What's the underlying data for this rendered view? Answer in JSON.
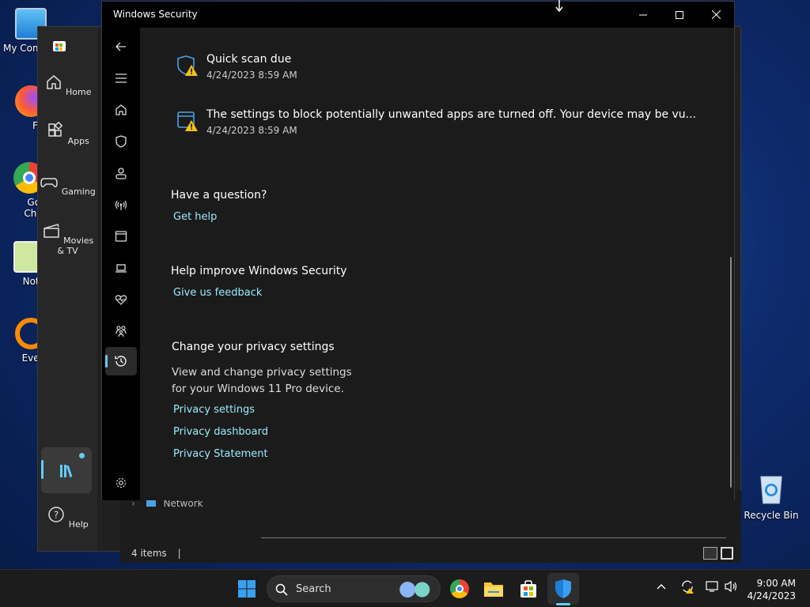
{
  "desktop": {
    "icons": [
      {
        "label": "My Com"
      },
      {
        "label": "Firefo"
      },
      {
        "label": "Goog Chron"
      },
      {
        "label": "Notepa"
      },
      {
        "label": "Everyth"
      }
    ],
    "recycle_bin": {
      "label": "Recycle Bin"
    }
  },
  "store": {
    "rail": [
      {
        "label": "Home"
      },
      {
        "label": "Apps"
      },
      {
        "label": "Gaming"
      },
      {
        "label": "Movies & TV"
      }
    ],
    "help_label": "Help"
  },
  "explorer": {
    "network_label": "Network",
    "status": "4 items"
  },
  "security": {
    "title": "Windows Security",
    "notifications": [
      {
        "title": "Quick scan due",
        "time": "4/24/2023 8:59 AM"
      },
      {
        "title": "The settings to block potentially unwanted apps are turned off. Your device may be vu...",
        "time": "4/24/2023 8:59 AM"
      }
    ],
    "question": {
      "heading": "Have a question?",
      "link": "Get help"
    },
    "improve": {
      "heading": "Help improve Windows Security",
      "link": "Give us feedback"
    },
    "privacy": {
      "heading": "Change your privacy settings",
      "description_line1": "View and change privacy settings",
      "description_line2": "for your Windows 11 Pro device.",
      "links": [
        "Privacy settings",
        "Privacy dashboard",
        "Privacy Statement"
      ]
    }
  },
  "taskbar": {
    "search_label": "Search",
    "time": "9:00 AM",
    "date": "4/24/2023"
  },
  "colors": {
    "accent": "#60cdff",
    "link": "#99ebff",
    "warning": "#f5c211"
  }
}
